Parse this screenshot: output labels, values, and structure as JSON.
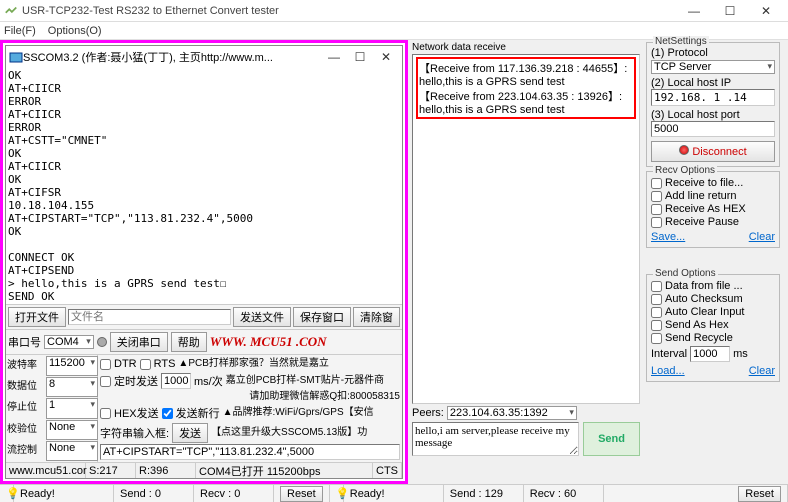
{
  "window": {
    "title": "USR-TCP232-Test  RS232 to Ethernet Convert tester",
    "menu": {
      "file": "File(F)",
      "options": "Options(O)"
    }
  },
  "sscom": {
    "title": "SSCOM3.2 (作者:聂小猛(丁丁), 主页http://www.m...",
    "terminal": "OK\nAT+CIICR\nERROR\nAT+CIICR\nERROR\nAT+CSTT=\"CMNET\"\nOK\nAT+CIICR\nOK\nAT+CIFSR\n10.18.104.155\nAT+CIPSTART=\"TCP\",\"113.81.232.4\",5000\nOK\n\nCONNECT OK\nAT+CIPSEND\n> hello,this is a GPRS send test☐\nSEND OK\nAT+CIPCLOSE\nCLOSE OK\n☐AT+CIPSTART=\"TCP\",\"113.81.232.4\",5000\nOK\n\nCONNECT OK\nhello,i am server,please receive my message",
    "toolbar1": {
      "openfile": "打开文件",
      "filename": "文件名",
      "sendfile": "发送文件",
      "savewin": "保存窗口",
      "clearwin": "清除窗"
    },
    "toolbar2": {
      "port_label": "串口号",
      "port": "COM4",
      "close": "关闭串口",
      "help": "帮助",
      "mcu": "WWW. MCU51 .CON"
    },
    "grid": {
      "baud_lbl": "波特率",
      "baud": "115200",
      "databits_lbl": "数据位",
      "databits": "8",
      "stopbits_lbl": "停止位",
      "stopbits": "1",
      "parity_lbl": "校验位",
      "parity": "None",
      "flow_lbl": "流控制",
      "flow": "None",
      "dtr": "DTR",
      "rts": "RTS",
      "timed": "定时发送",
      "interval": "1000",
      "interval_unit": "ms/次",
      "hex": "HEX发送",
      "newline": "发送新行",
      "inputlbl": "字符串输入框:",
      "send": "发送",
      "cmd": "AT+CIPSTART=\"TCP\",\"113.81.232.4\",5000",
      "ad1": "▲PCB打样那家强？当然就是嘉立",
      "ad2": "嘉立创PCB打样-SMT贴片-元器件商",
      "ad3": "请加助理微信解惑Q扣:800058315",
      "ad4": "▲品牌推荐:WiFi/Gprs/GPS【安信",
      "ad5": "【点这里升级大SSCOM5.13版】功"
    },
    "status": {
      "url": "www.mcu51.cor",
      "s": "S:217",
      "r": "R:396",
      "port": "COM4已打开  115200bps",
      "cts": "CTS"
    }
  },
  "net": {
    "recv_label": "Network data receive",
    "recv1": "【Receive from 117.136.39.218 : 44655】:",
    "recv2": "hello,this is a GPRS send test",
    "recv3": "【Receive from 223.104.63.35 : 13926】:",
    "recv4": "hello,this is a GPRS send test",
    "peers_label": "Peers:",
    "peers": "223.104.63.35:1392",
    "sendtext": "hello,i am server,please receive my message",
    "send": "Send"
  },
  "settings": {
    "legend": "NetSettings",
    "proto_lbl": "(1) Protocol",
    "proto": "TCP Server",
    "ip_lbl": "(2) Local host IP",
    "ip": "192.168. 1 .14",
    "port_lbl": "(3) Local host port",
    "port": "5000",
    "disconnect": "Disconnect"
  },
  "recvopt": {
    "legend": "Recv Options",
    "tofile": "Receive to file...",
    "addline": "Add line return",
    "ashex": "Receive As HEX",
    "pause": "Receive Pause",
    "save": "Save...",
    "clear": "Clear"
  },
  "sendopt": {
    "legend": "Send Options",
    "fromfile": "Data from file ...",
    "autocksum": "Auto Checksum",
    "autoclear": "Auto Clear Input",
    "ashex": "Send As Hex",
    "recycle": "Send Recycle",
    "interval_lbl": "Interval",
    "interval": "1000",
    "ms": "ms",
    "load": "Load...",
    "clear": "Clear"
  },
  "status": {
    "ready1": "Ready!",
    "send0": "Send : 0",
    "recv0": "Recv : 0",
    "reset1": "Reset",
    "ready2": "Ready!",
    "send129": "Send : 129",
    "recv60": "Recv : 60",
    "reset2": "Reset"
  }
}
